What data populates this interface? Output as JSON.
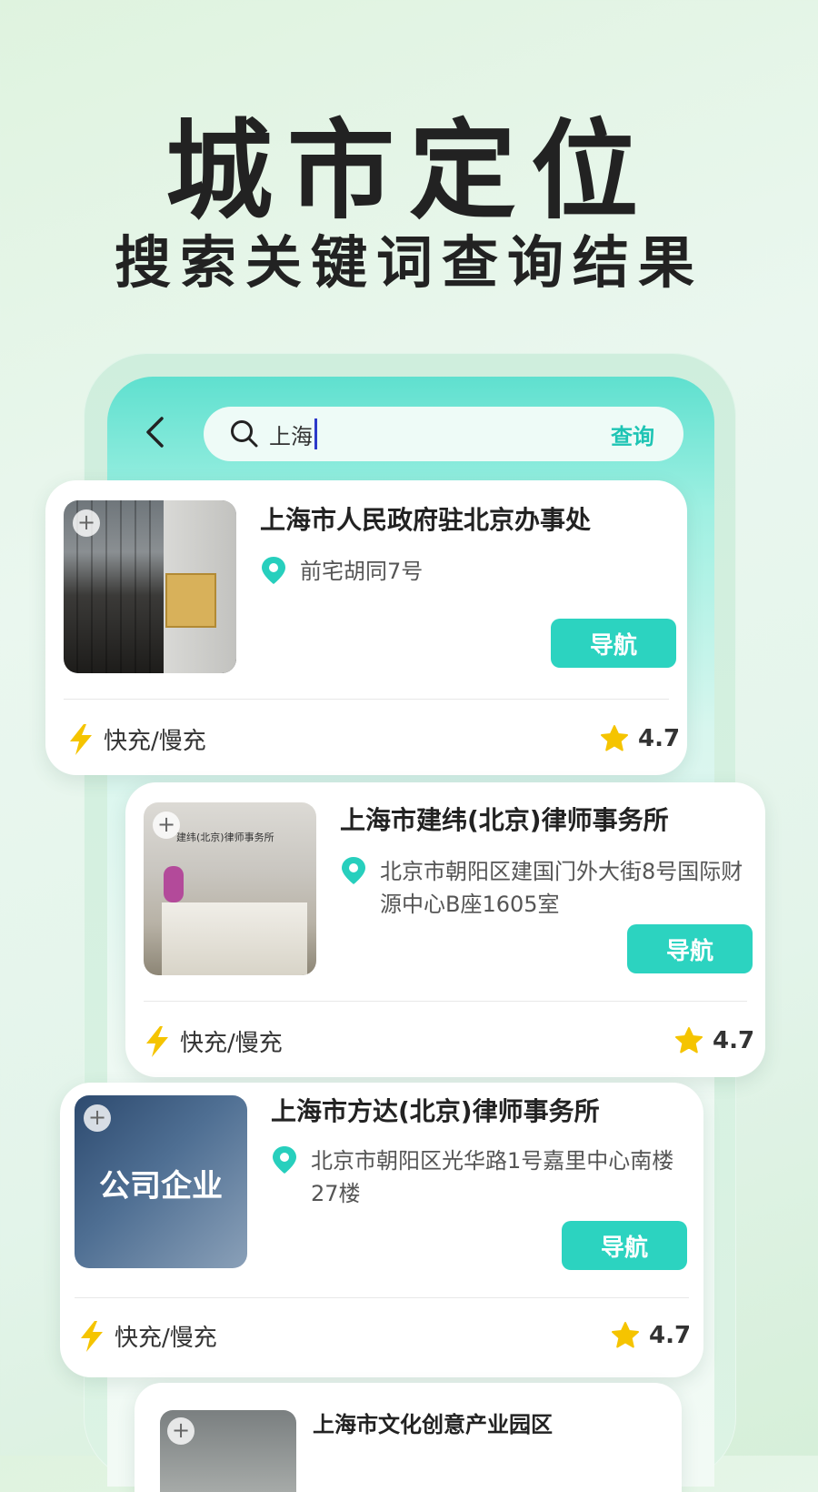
{
  "hero": {
    "title": "城市定位",
    "subtitle": "搜索关键词查询结果"
  },
  "search": {
    "back_icon": "chevron-left-icon",
    "search_icon": "search-icon",
    "query": "上海",
    "button_label": "查询"
  },
  "results": [
    {
      "name": "上海市人民政府驻北京办事处",
      "address": "前宅胡同7号",
      "nav_label": "导航",
      "charge": "快充/慢充",
      "rating": "4.7"
    },
    {
      "name": "上海市建纬(北京)律师事务所",
      "address": "北京市朝阳区建国门外大街8号国际财源中心B座1605室",
      "nav_label": "导航",
      "charge": "快充/慢充",
      "rating": "4.7"
    },
    {
      "name": "上海市方达(北京)律师事务所",
      "address": "北京市朝阳区光华路1号嘉里中心南楼27楼",
      "thumb_label": "公司企业",
      "nav_label": "导航",
      "charge": "快充/慢充",
      "rating": "4.7"
    },
    {
      "name": "上海市文化创意产业园区"
    }
  ],
  "colors": {
    "accent": "#2cd3c0",
    "search_button": "#1ec4b4",
    "pin": "#27cfbd",
    "bolt": "#f5c400",
    "star": "#f5c400"
  }
}
